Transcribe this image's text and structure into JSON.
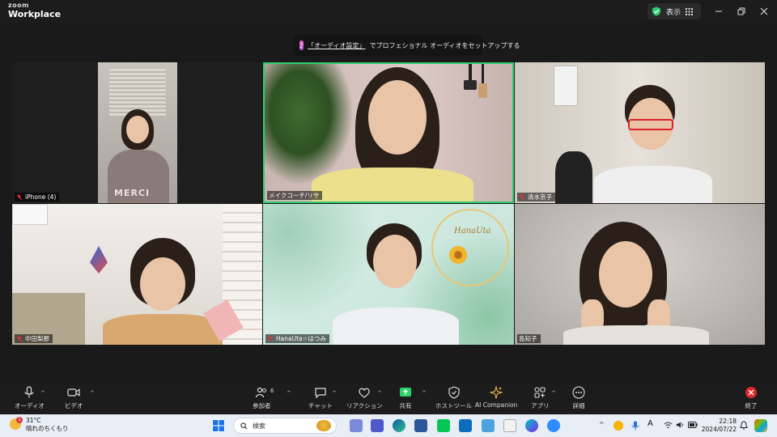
{
  "app": {
    "logo_top": "zoom",
    "logo_bottom": "Workplace",
    "view_label": "表示"
  },
  "banner": {
    "link_text": "「オーディオ設定」",
    "text": "でプロフェショナル オーディオをセットアップする"
  },
  "participants": [
    {
      "name": "iPhone (4)",
      "muted": true
    },
    {
      "name": "メイクコーチ/リサ",
      "muted": false,
      "active_speaker": true
    },
    {
      "name": "清水京子",
      "muted": true
    },
    {
      "name": "中田梨那",
      "muted": true
    },
    {
      "name": "HanaUta☆はつみ",
      "muted": true
    },
    {
      "name": "島知子",
      "muted": false
    }
  ],
  "tile_decor": {
    "hanauta_script": "HanaUta",
    "shirt_text": "MERCI"
  },
  "toolbar": {
    "audio": "オーディオ",
    "video": "ビデオ",
    "participants": "参加者",
    "participants_count": "6",
    "chat": "チャット",
    "reactions": "リアクション",
    "share": "共有",
    "host_tools": "ホストツール",
    "ai_companion": "AI Companion",
    "apps": "アプリ",
    "more": "詳細",
    "end": "終了"
  },
  "taskbar": {
    "weather_temp": "31°C",
    "weather_desc": "晴れのちくもり",
    "weather_badge": "1",
    "search_placeholder": "検索",
    "time": "22:18",
    "date": "2024/07/22"
  },
  "colors": {
    "active_speaker_border": "#2ecc71",
    "share_green": "#2bd46a",
    "end_red": "#e02828"
  }
}
